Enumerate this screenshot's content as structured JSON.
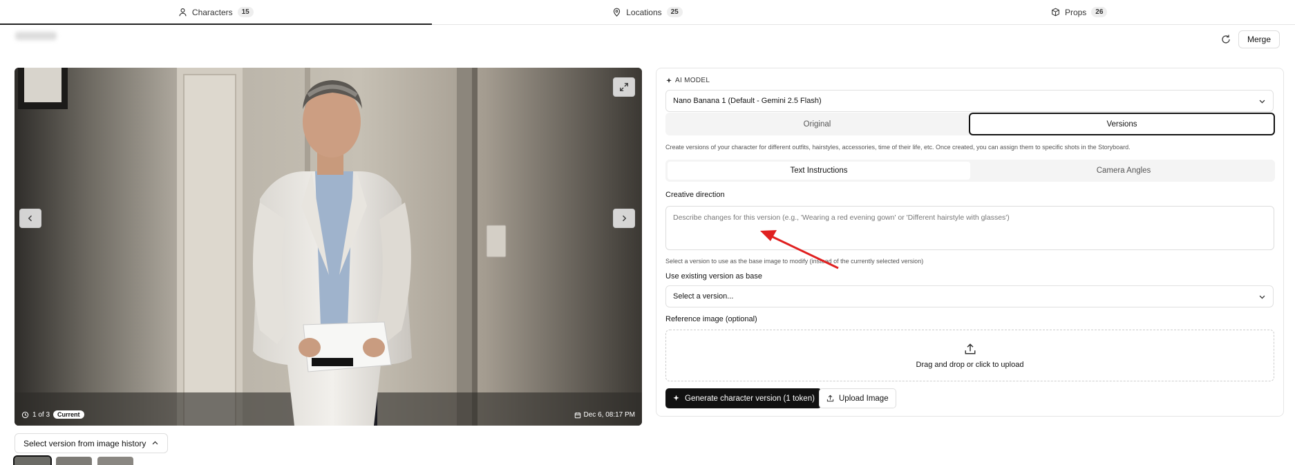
{
  "tabs": [
    {
      "label": "Characters",
      "count": "15"
    },
    {
      "label": "Locations",
      "count": "25"
    },
    {
      "label": "Props",
      "count": "26"
    }
  ],
  "toolbar": {
    "merge_label": "Merge"
  },
  "viewer": {
    "counter": "1 of 3",
    "current_badge": "Current",
    "date": "Dec 6, 08:17 PM"
  },
  "history": {
    "button_label": "Select version from image history"
  },
  "panel": {
    "ai_model_label": "AI MODEL",
    "model_value": "Nano Banana 1 (Default - Gemini 2.5 Flash)",
    "mode_tabs": [
      "Original",
      "Versions"
    ],
    "mode_help": "Create versions of your character for different outfits, hairstyles, accessories, time of their life, etc. Once created, you can assign them to specific shots in the Storyboard.",
    "sub_tabs": [
      "Text Instructions",
      "Camera Angles"
    ],
    "creative_label": "Creative direction",
    "creative_placeholder": "Describe changes for this version (e.g., 'Wearing a red evening gown' or 'Different hairstyle with glasses')",
    "base_help": "Select a version to use as the base image to modify (instead of the currently selected version)",
    "base_label": "Use existing version as base",
    "base_placeholder": "Select a version...",
    "ref_label": "Reference image (optional)",
    "drop_text": "Drag and drop or click to upload",
    "generate_label": "Generate character version (1 token)",
    "upload_label": "Upload Image"
  },
  "colors": {
    "accent": "#111111",
    "annotation_arrow": "#e02020"
  }
}
